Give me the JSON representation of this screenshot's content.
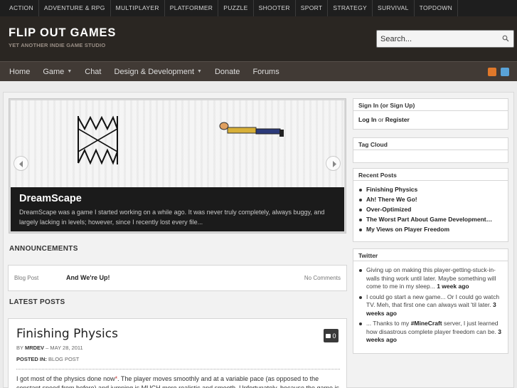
{
  "categories": [
    "ACTION",
    "ADVENTURE & RPG",
    "MULTIPLAYER",
    "PLATFORMER",
    "PUZZLE",
    "SHOOTER",
    "SPORT",
    "STRATEGY",
    "SURVIVAL",
    "TOPDOWN"
  ],
  "header": {
    "title": "FLIP OUT GAMES",
    "tagline": "YET ANOTHER INDIE GAME STUDIO"
  },
  "search": {
    "value": "Search..."
  },
  "nav": [
    {
      "label": "Home"
    },
    {
      "label": "Game",
      "dropdown": true
    },
    {
      "label": "Chat"
    },
    {
      "label": "Design & Development",
      "dropdown": true
    },
    {
      "label": "Donate"
    },
    {
      "label": "Forums"
    }
  ],
  "slider": {
    "title": "DreamScape",
    "text": "DreamScape was a game I started working on a while ago. It was never truly completely, always buggy, and largely lacking in levels; however, since I recently lost every file..."
  },
  "announcements": {
    "heading": "ANNOUNCEMENTS",
    "type": "Blog Post",
    "title": "And We're Up!",
    "comments": "No Comments"
  },
  "latest": {
    "heading": "LATEST POSTS",
    "title": "Finishing Physics",
    "by": "BY",
    "author": "MRDEV",
    "date": "– MAY 28, 2011",
    "posted_in_label": "POSTED IN:",
    "category": "BLOG POST",
    "comment_count": "0",
    "excerpt_1": "I got most of the physics done now",
    "excerpt_star": "*",
    "excerpt_2": ". The player moves smoothly and at a variable pace (as opposed to the constant speed from before) and jumping is MUCH more realistic and smooth. Unfortunately, because the game is"
  },
  "sidebar": {
    "signin": {
      "title": "Sign In (or Sign Up)",
      "login": "Log In",
      "or": " or ",
      "register": "Register"
    },
    "tagcloud": {
      "title": "Tag Cloud"
    },
    "recent": {
      "title": "Recent Posts",
      "items": [
        "Finishing Physics",
        "Ah! There We Go!",
        "Over-Optimized",
        "The Worst Part About Game Development…",
        "My Views on Player Freedom"
      ]
    },
    "twitter": {
      "title": "Twitter",
      "t1_text": "Giving up on making this player-getting-stuck-in-walls thing work until later. Maybe something will come to me in my sleep...",
      "t1_time": "1 week ago",
      "t2_text": "I could go start a new game... Or I could go watch TV. Meh, that first one can always wait 'til later.",
      "t2_time": "3 weeks ago",
      "t3_pre": "... Thanks to my",
      "t3_tag": "#MineCraft",
      "t3_post": "server, I just learned how disastrous complete player freedom can be.",
      "t3_time": "3 weeks ago"
    }
  },
  "colors": {
    "topbar": "#1e1e1e",
    "header": "#2a2622",
    "nav": "#413a35",
    "rss": "#e0782a",
    "twitter": "#5aa3d8"
  }
}
